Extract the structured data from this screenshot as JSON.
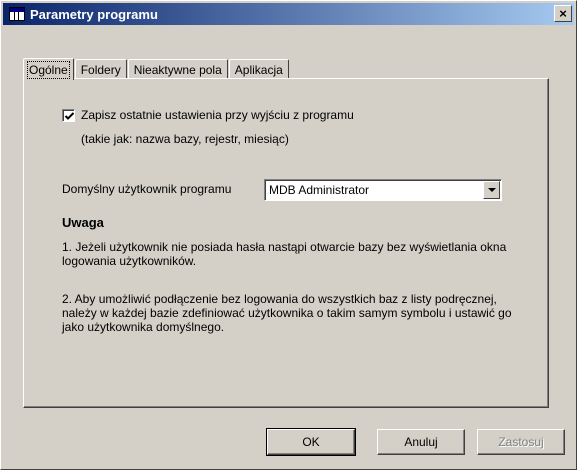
{
  "window": {
    "title": "Parametry programu",
    "close_label": "×"
  },
  "tabs": [
    {
      "label": "Ogólne",
      "active": true
    },
    {
      "label": "Foldery",
      "active": false
    },
    {
      "label": "Nieaktywne pola",
      "active": false
    },
    {
      "label": "Aplikacja",
      "active": false
    }
  ],
  "general": {
    "save_settings": {
      "checked": true,
      "label": "Zapisz ostatnie ustawienia przy wyjściu z programu",
      "note": "(takie jak: nazwa bazy, rejestr, miesiąc)"
    },
    "default_user": {
      "label": "Domyślny użytkownik programu",
      "value": "MDB Administrator"
    },
    "warning": {
      "heading": "Uwaga",
      "note1": "1. Jeżeli użytkownik nie posiada hasła nastąpi otwarcie bazy bez wyświetlania okna logowania użytkowników.",
      "note2": "2. Aby umożliwić podłączenie bez logowania do wszystkich baz z listy podręcznej, należy w każdej bazie zdefiniować użytkownika o takim samym symbolu i ustawić go jako użytkownika domyślnego."
    }
  },
  "buttons": {
    "ok": "OK",
    "cancel": "Anuluj",
    "apply": "Zastosuj"
  },
  "colors": {
    "title_gradient_start": "#0a246a",
    "title_gradient_end": "#a6caf0",
    "face": "#d4d0c8"
  }
}
